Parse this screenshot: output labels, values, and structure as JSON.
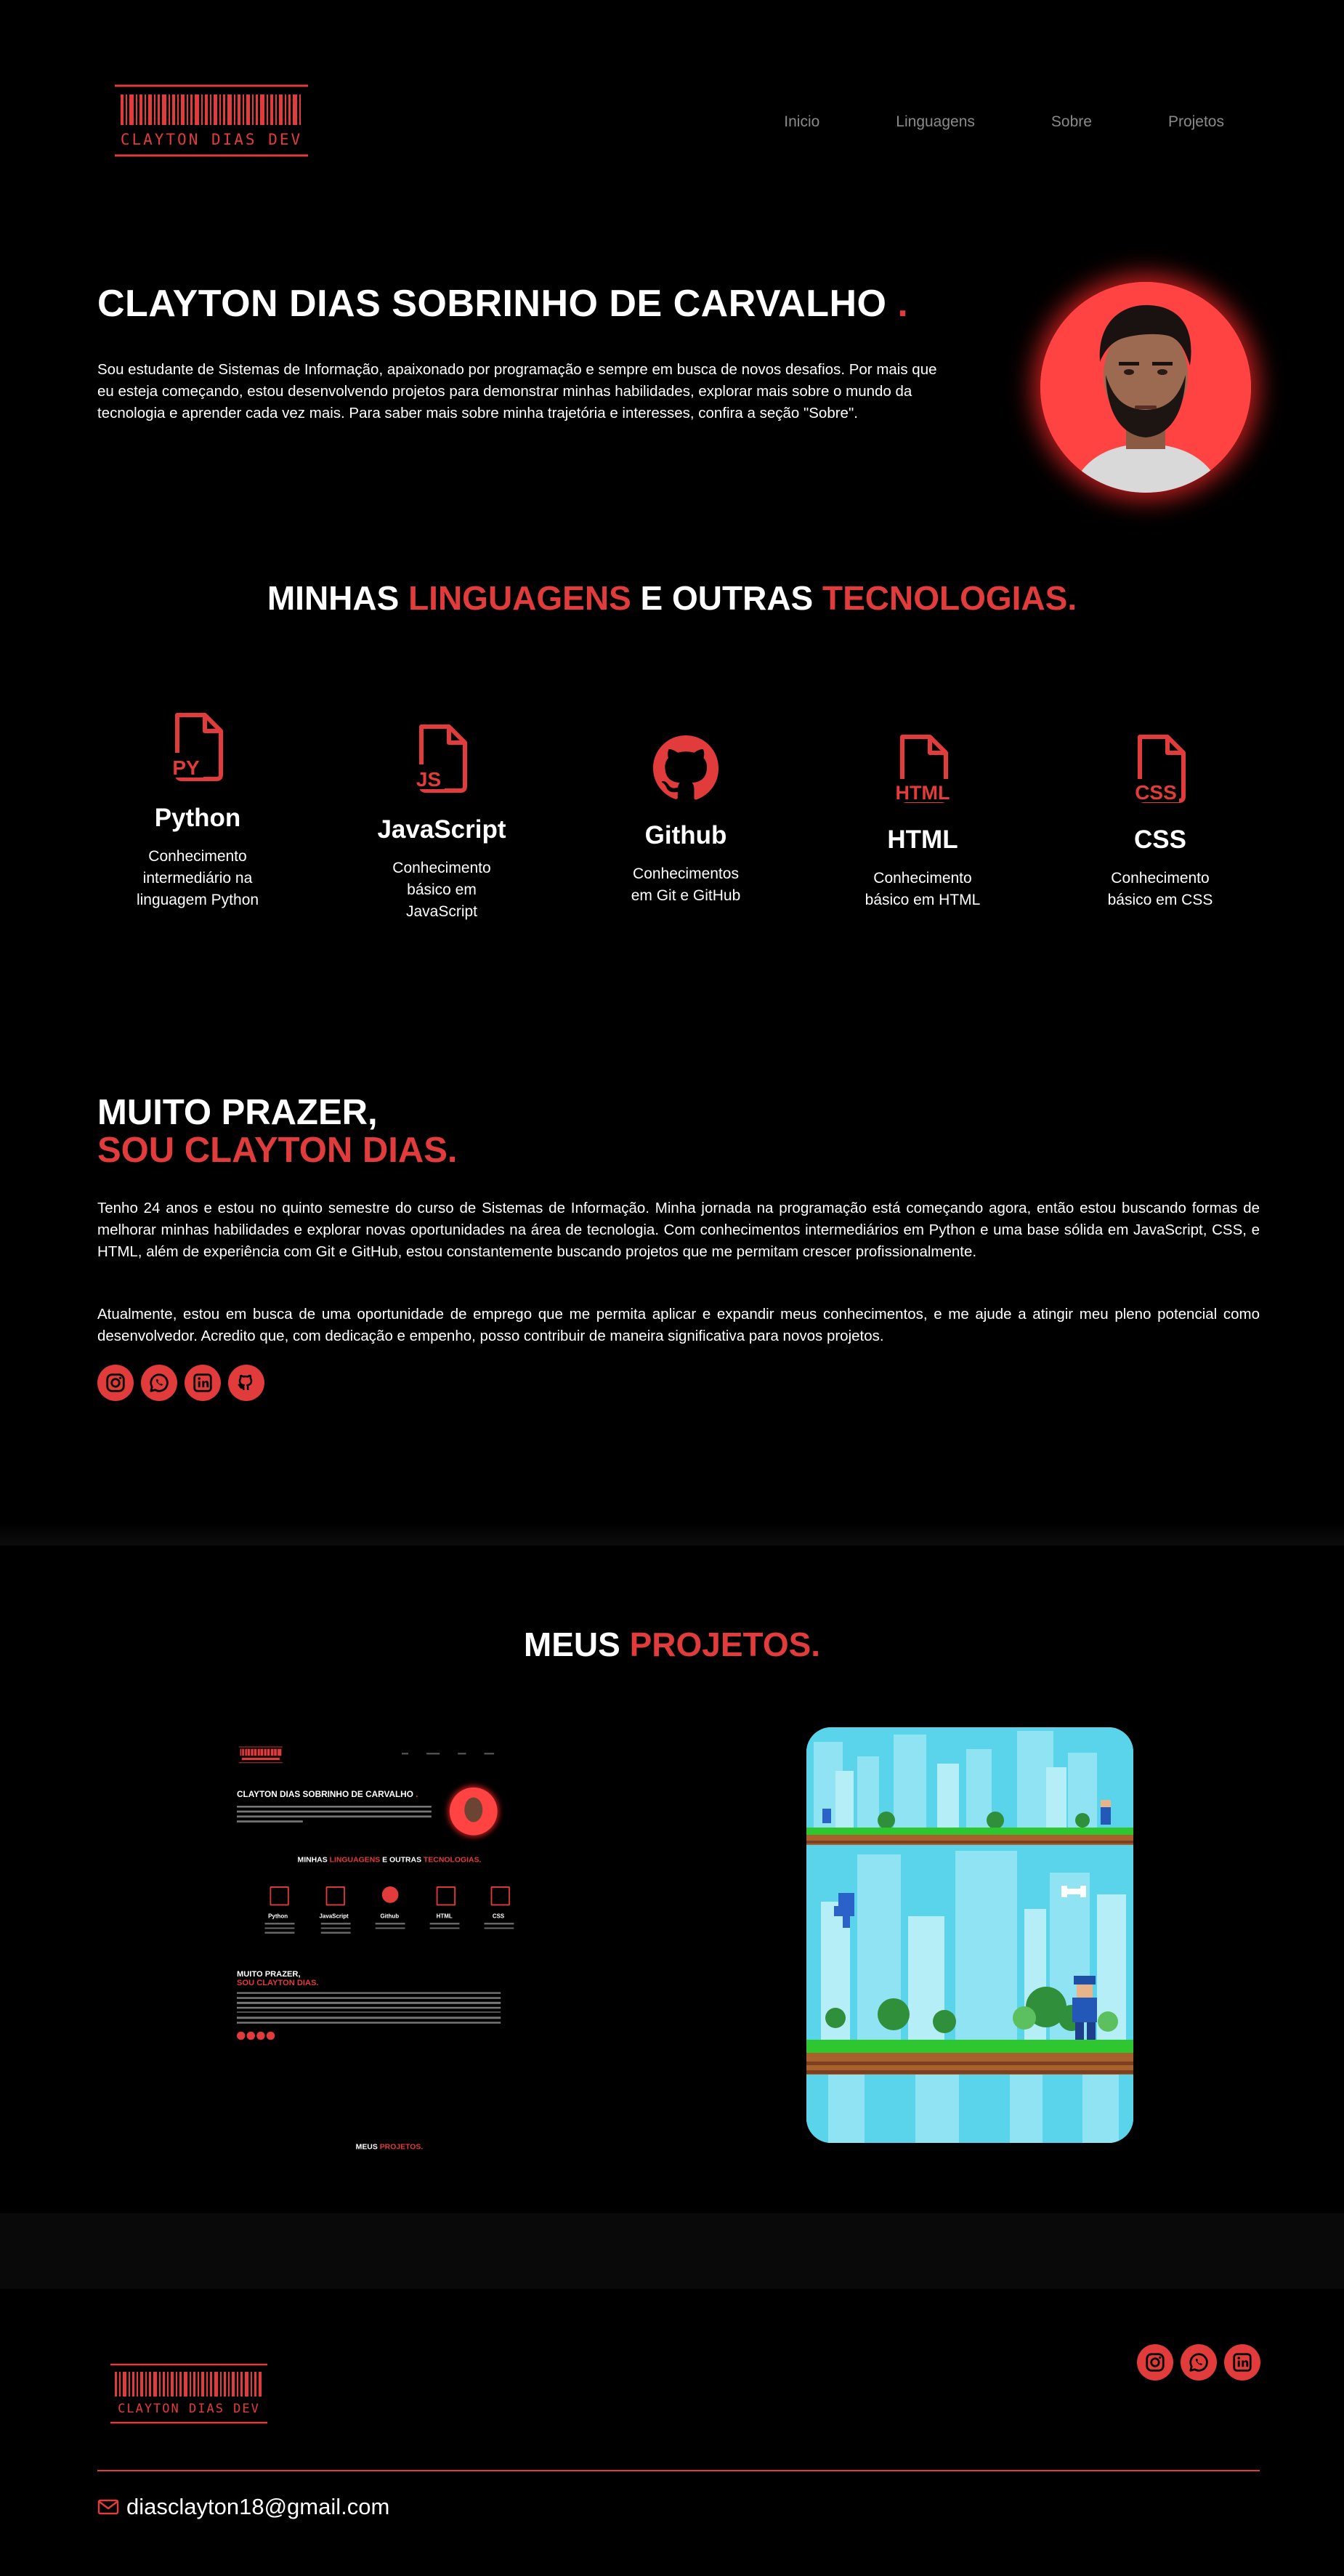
{
  "header": {
    "logo_text": "CLAYTON DIAS DEV",
    "nav": [
      "Inicio",
      "Linguagens",
      "Sobre",
      "Projetos"
    ]
  },
  "hero": {
    "name": "CLAYTON DIAS SOBRINHO DE CARVALHO",
    "dot": ".",
    "bio": "Sou estudante de Sistemas de Informação, apaixonado por programação e sempre em busca de novos desafios. Por mais que eu esteja começando, estou desenvolvendo projetos para demonstrar minhas habilidades, explorar mais sobre o mundo da tecnologia e aprender cada vez mais. Para saber mais sobre minha trajetória e interesses, confira a seção \"Sobre\"."
  },
  "skills_title": {
    "a": "MINHAS ",
    "b": "LINGUAGENS",
    "c": " E OUTRAS ",
    "d": "TECNOLOGIAS."
  },
  "skills": [
    {
      "name": "Python",
      "desc": "Conhecimento intermediário na linguagem Python",
      "icon": "python-file-icon",
      "tag": "PY"
    },
    {
      "name": "JavaScript",
      "desc": "Conhecimento básico em JavaScript",
      "icon": "javascript-file-icon",
      "tag": "JS"
    },
    {
      "name": "Github",
      "desc": "Conhecimentos em Git e GitHub",
      "icon": "github-icon",
      "tag": ""
    },
    {
      "name": "HTML",
      "desc": "Conhecimento básico em HTML",
      "icon": "html-file-icon",
      "tag": "HTML"
    },
    {
      "name": "CSS",
      "desc": "Conhecimento básico em CSS",
      "icon": "css-file-icon",
      "tag": "CSS"
    }
  ],
  "about": {
    "line1": "MUITO PRAZER,",
    "line2": "SOU CLAYTON DIAS.",
    "p1": "Tenho 24 anos e estou no quinto semestre do curso de Sistemas de Informação. Minha jornada na programação está começando agora, então estou buscando formas de melhorar minhas habilidades e explorar novas oportunidades na área de tecnologia. Com conhecimentos intermediários em Python e uma base sólida em JavaScript, CSS, e HTML, além de experiência com Git e GitHub, estou constantemente buscando projetos que me permitam crescer profissionalmente.",
    "p2": "Atualmente, estou em busca de uma oportunidade de emprego que me permita aplicar e expandir meus conhecimentos, e me ajude a atingir meu pleno potencial como desenvolvedor. Acredito que, com dedicação e empenho, posso contribuir de maneira significativa para novos projetos.",
    "social": [
      "instagram-icon",
      "whatsapp-icon",
      "linkedin-icon",
      "github-icon"
    ]
  },
  "projects_title": {
    "a": "MEUS ",
    "b": "PROJETOS."
  },
  "footer": {
    "logo_text": "CLAYTON DIAS DEV",
    "social": [
      "instagram-icon",
      "whatsapp-icon",
      "linkedin-icon"
    ],
    "email": "diasclayton18@gmail.com"
  },
  "colors": {
    "accent": "#e23b3b",
    "background": "#000000",
    "nav_text": "#8a8a8a"
  }
}
